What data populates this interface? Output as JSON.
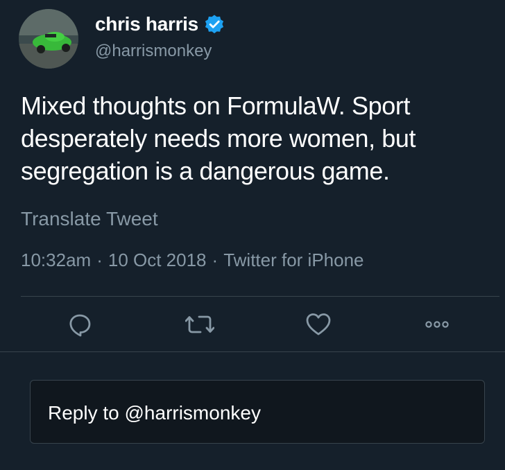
{
  "user": {
    "display_name": "chris harris",
    "handle": "@harrismonkey",
    "verified": true
  },
  "tweet": {
    "lines": [
      "Mixed thoughts on FormulaW. Sport",
      "desperately needs more women, but",
      "segregation is a dangerous game."
    ],
    "translate_label": "Translate Tweet",
    "time": "10:32am",
    "date": "10 Oct 2018",
    "source": "Twitter for iPhone",
    "separator": "·"
  },
  "actions": {
    "reply_icon": "reply-icon",
    "retweet_icon": "retweet-icon",
    "like_icon": "heart-icon",
    "more_icon": "more-icon"
  },
  "reply": {
    "placeholder": "Reply to @harrismonkey"
  },
  "colors": {
    "background": "#15202b",
    "secondary_text": "#8899a6",
    "verified_blue": "#1da1f2",
    "divider": "#38444d",
    "reply_box_bg": "#10171e"
  }
}
